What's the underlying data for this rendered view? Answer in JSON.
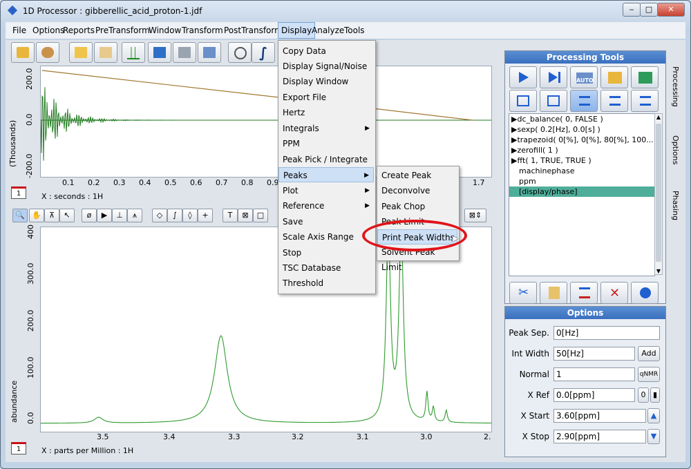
{
  "window": {
    "title": "1D Processor : gibberellic_acid_proton-1.jdf"
  },
  "menubar": {
    "items": [
      "File",
      "Options",
      "Reports",
      "PreTransform",
      "Window",
      "Transform",
      "PostTransform",
      "Display",
      "Analyze",
      "Tools"
    ]
  },
  "display_menu": {
    "items": [
      "Copy Data",
      "Display Signal/Noise",
      "Display Window",
      "Export File",
      "Hertz",
      "Integrals",
      "PPM",
      "Peak Pick / Integrate",
      "Peaks",
      "Plot",
      "Reference",
      "Save",
      "Scale Axis Range",
      "Stop",
      "TSC Database",
      "Threshold"
    ]
  },
  "peaks_submenu": {
    "items": [
      "Create Peak",
      "Deconvolve",
      "Peak Chop",
      "Peak Limit",
      "Print Peak Widths",
      "Solvent Peak Limit"
    ],
    "highlighted": "Print Peak Widths"
  },
  "top_plot": {
    "ylabel": "(Thousands)",
    "yticks": [
      "200.0",
      "0.0",
      "-200.0"
    ],
    "xticks": [
      "0.1",
      "0.2",
      "0.3",
      "0.4",
      "0.5",
      "0.6",
      "0.7",
      "0.8",
      "0.9",
      "1.7"
    ],
    "xlabel": "X : seconds : 1H",
    "badge": "1"
  },
  "bottom_plot": {
    "ylabel": "abundance",
    "yticks": [
      "400",
      "300.0",
      "200.0",
      "100.0",
      "0.0"
    ],
    "xticks": [
      "3.5",
      "3.4",
      "3.3",
      "3.2",
      "3.1",
      "3.0",
      "2."
    ],
    "xlabel": "X : parts per Million : 1H",
    "badge": "1"
  },
  "processing_tools": {
    "title": "Processing Tools",
    "list": [
      "▶dc_balance( 0, FALSE )",
      "▶sexp( 0.2[Hz], 0.0[s] )",
      "▶trapezoid( 0[%], 0[%], 80[%], 100...",
      "▶zerofill( 1 )",
      "▶fft( 1, TRUE, TRUE )",
      "machinephase",
      "ppm",
      "[display/phase]"
    ],
    "selected_index": 7
  },
  "options": {
    "title": "Options",
    "fields": [
      {
        "label": "Peak Sep.",
        "value": "0[Hz]"
      },
      {
        "label": "Int Width",
        "value": "50[Hz]",
        "button": "Add"
      },
      {
        "label": "Normal",
        "value": "1",
        "button": "qNMR"
      },
      {
        "label": "X Ref",
        "value": "0.0[ppm]",
        "button": "0"
      },
      {
        "label": "X Start",
        "value": "3.60[ppm]"
      },
      {
        "label": "X Stop",
        "value": "2.90[ppm]"
      }
    ]
  },
  "side_tabs": [
    "Processing",
    "Options",
    "Phasing"
  ],
  "chart_data": [
    {
      "type": "line",
      "ylabel": "(Thousands)",
      "xlabel": "X : seconds : 1H",
      "xlim": [
        0,
        1.75
      ],
      "ylim": [
        -280,
        280
      ],
      "series": [
        {
          "values": "decaying FID signal"
        },
        {
          "values": "trapezoid window"
        }
      ]
    },
    {
      "type": "line",
      "ylabel": "abundance",
      "xlabel": "X : parts per Million : 1H",
      "xlim": [
        3.6,
        2.9
      ],
      "ylim": [
        0,
        400
      ],
      "peaks": [
        {
          "x": 3.51,
          "y": 12
        },
        {
          "x": 3.32,
          "y": 180
        },
        {
          "x": 3.06,
          "y": 400
        },
        {
          "x": 3.04,
          "y": 400
        },
        {
          "x": 3.0,
          "y": 60
        },
        {
          "x": 2.99,
          "y": 30
        },
        {
          "x": 2.97,
          "y": 25
        }
      ]
    }
  ],
  "colors": {
    "fid": "#1f7a1f",
    "window": "#a07830",
    "spectrum": "#2e9b2e",
    "highlight_circle": "#e0141a",
    "list_selected": "#4fae9a"
  }
}
